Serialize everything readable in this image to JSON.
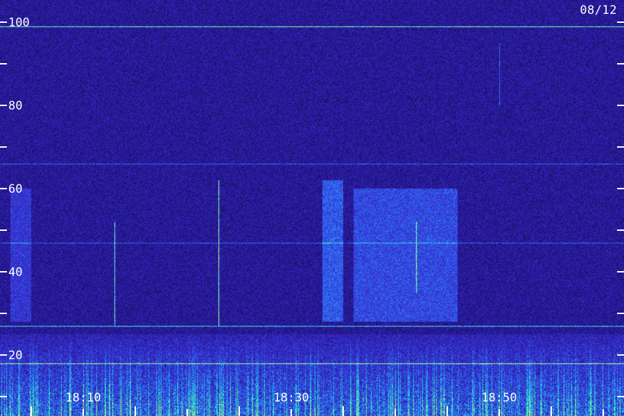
{
  "date_label": "08/12",
  "chart_data": {
    "type": "heatmap",
    "title": "",
    "xlabel": "",
    "ylabel": "",
    "ylim": [
      10,
      100
    ],
    "y_major_ticks": [
      20,
      40,
      60,
      80,
      100
    ],
    "y_minor_ticks": [
      10,
      30,
      50,
      70,
      90
    ],
    "x_tick_labels": [
      "18:10",
      "18:30",
      "18:50"
    ],
    "x_range_minutes": [
      "18:02",
      "19:02"
    ],
    "colormap": [
      "#0a0430",
      "#2a1aa0",
      "#3a3ae0",
      "#20a0ff",
      "#30ffb0",
      "#e8ff60"
    ],
    "features": {
      "horizontal_lines": [
        {
          "freq": 99,
          "intensity": 0.85
        },
        {
          "freq": 66,
          "intensity": 0.35
        },
        {
          "freq": 47,
          "intensity": 0.35
        },
        {
          "freq": 27,
          "intensity": 0.7
        },
        {
          "freq": 18,
          "intensity": 0.75
        }
      ],
      "vertical_spikes": [
        {
          "time": "18:13",
          "freq_from": 27,
          "freq_to": 52,
          "intensity": 0.75
        },
        {
          "time": "18:23",
          "freq_from": 27,
          "freq_to": 62,
          "intensity": 0.9
        },
        {
          "time": "18:42",
          "freq_from": 35,
          "freq_to": 52,
          "intensity": 0.6
        },
        {
          "time": "18:50",
          "freq_from": 80,
          "freq_to": 95,
          "intensity": 0.35
        }
      ],
      "broadband_regions": [
        {
          "time_from": "18:33",
          "time_to": "18:35",
          "freq_from": 28,
          "freq_to": 62,
          "intensity": 0.35
        },
        {
          "time_from": "18:36",
          "time_to": "18:46",
          "freq_from": 28,
          "freq_to": 60,
          "intensity": 0.3
        },
        {
          "time_from": "18:03",
          "time_to": "18:05",
          "freq_from": 28,
          "freq_to": 60,
          "intensity": 0.22
        }
      ],
      "noise_floor": [
        {
          "freq_from": 10,
          "freq_to": 25,
          "intensity": 0.7
        }
      ]
    }
  }
}
